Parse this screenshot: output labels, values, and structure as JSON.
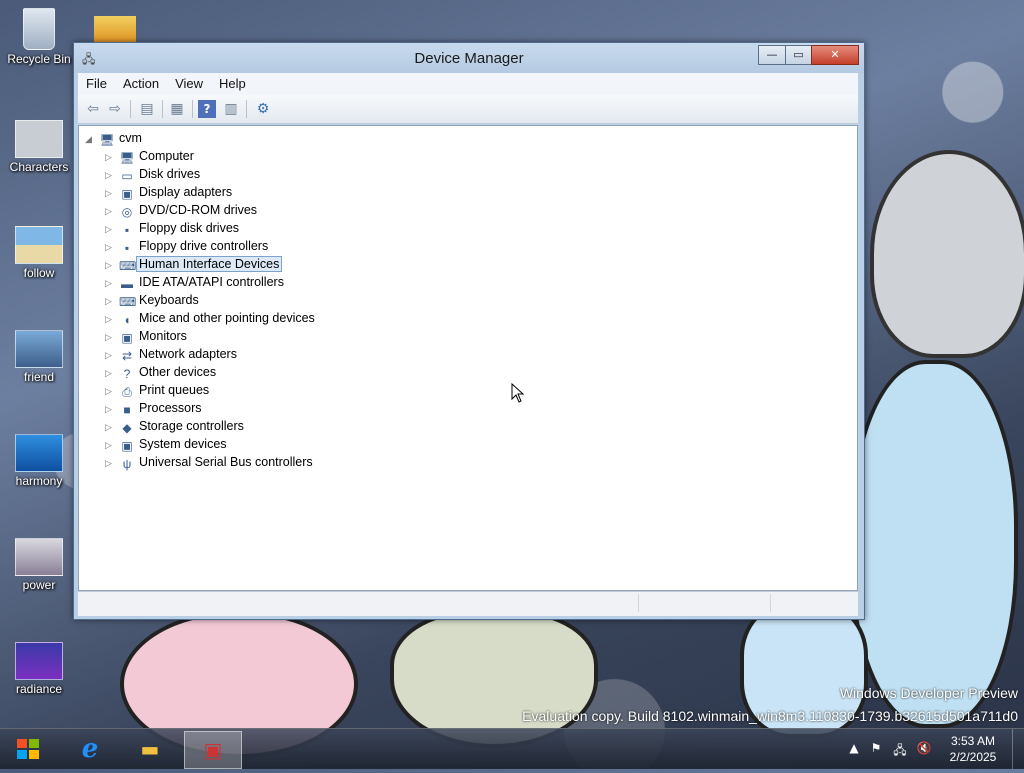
{
  "desktop": {
    "icons": [
      {
        "label": "Recycle Bin",
        "icon": "recycle-bin-icon"
      },
      {
        "label": "Characters",
        "icon": "folder-image-icon"
      },
      {
        "label": "follow",
        "icon": "image-icon"
      },
      {
        "label": "friend",
        "icon": "image-icon"
      },
      {
        "label": "harmony",
        "icon": "image-icon"
      },
      {
        "label": "power",
        "icon": "image-icon"
      },
      {
        "label": "radiance",
        "icon": "image-icon"
      }
    ],
    "watermark": {
      "line1": "Windows Developer Preview",
      "line2": "Evaluation copy. Build 8102.winmain_win8m3.110830-1739.b32615d501a711d0"
    }
  },
  "window": {
    "title": "Device Manager",
    "controls": {
      "min": "—",
      "max": "▭",
      "close": "✕"
    },
    "menu": [
      "File",
      "Action",
      "View",
      "Help"
    ],
    "toolbar": [
      "back-icon",
      "forward-icon",
      "properties-icon",
      "scan-icon",
      "help-icon",
      "view-icon",
      "update-driver-icon"
    ],
    "tree": {
      "root": "cvm",
      "children": [
        {
          "label": "Computer",
          "icon": "computer-icon"
        },
        {
          "label": "Disk drives",
          "icon": "disk-drive-icon"
        },
        {
          "label": "Display adapters",
          "icon": "display-adapter-icon"
        },
        {
          "label": "DVD/CD-ROM drives",
          "icon": "dvd-drive-icon"
        },
        {
          "label": "Floppy disk drives",
          "icon": "floppy-icon"
        },
        {
          "label": "Floppy drive controllers",
          "icon": "floppy-controller-icon"
        },
        {
          "label": "Human Interface Devices",
          "icon": "hid-icon",
          "selected": true
        },
        {
          "label": "IDE ATA/ATAPI controllers",
          "icon": "ide-icon"
        },
        {
          "label": "Keyboards",
          "icon": "keyboard-icon"
        },
        {
          "label": "Mice and other pointing devices",
          "icon": "mouse-icon"
        },
        {
          "label": "Monitors",
          "icon": "monitor-icon"
        },
        {
          "label": "Network adapters",
          "icon": "network-icon"
        },
        {
          "label": "Other devices",
          "icon": "other-devices-icon"
        },
        {
          "label": "Print queues",
          "icon": "printer-icon"
        },
        {
          "label": "Processors",
          "icon": "processor-icon"
        },
        {
          "label": "Storage controllers",
          "icon": "storage-icon"
        },
        {
          "label": "System devices",
          "icon": "system-devices-icon"
        },
        {
          "label": "Universal Serial Bus controllers",
          "icon": "usb-icon"
        }
      ]
    }
  },
  "taskbar": {
    "apps": [
      "start-icon",
      "internet-explorer-icon",
      "file-explorer-icon",
      "device-manager-icon"
    ],
    "clock": {
      "time": "3:53 AM",
      "date": "2/2/2025"
    }
  }
}
